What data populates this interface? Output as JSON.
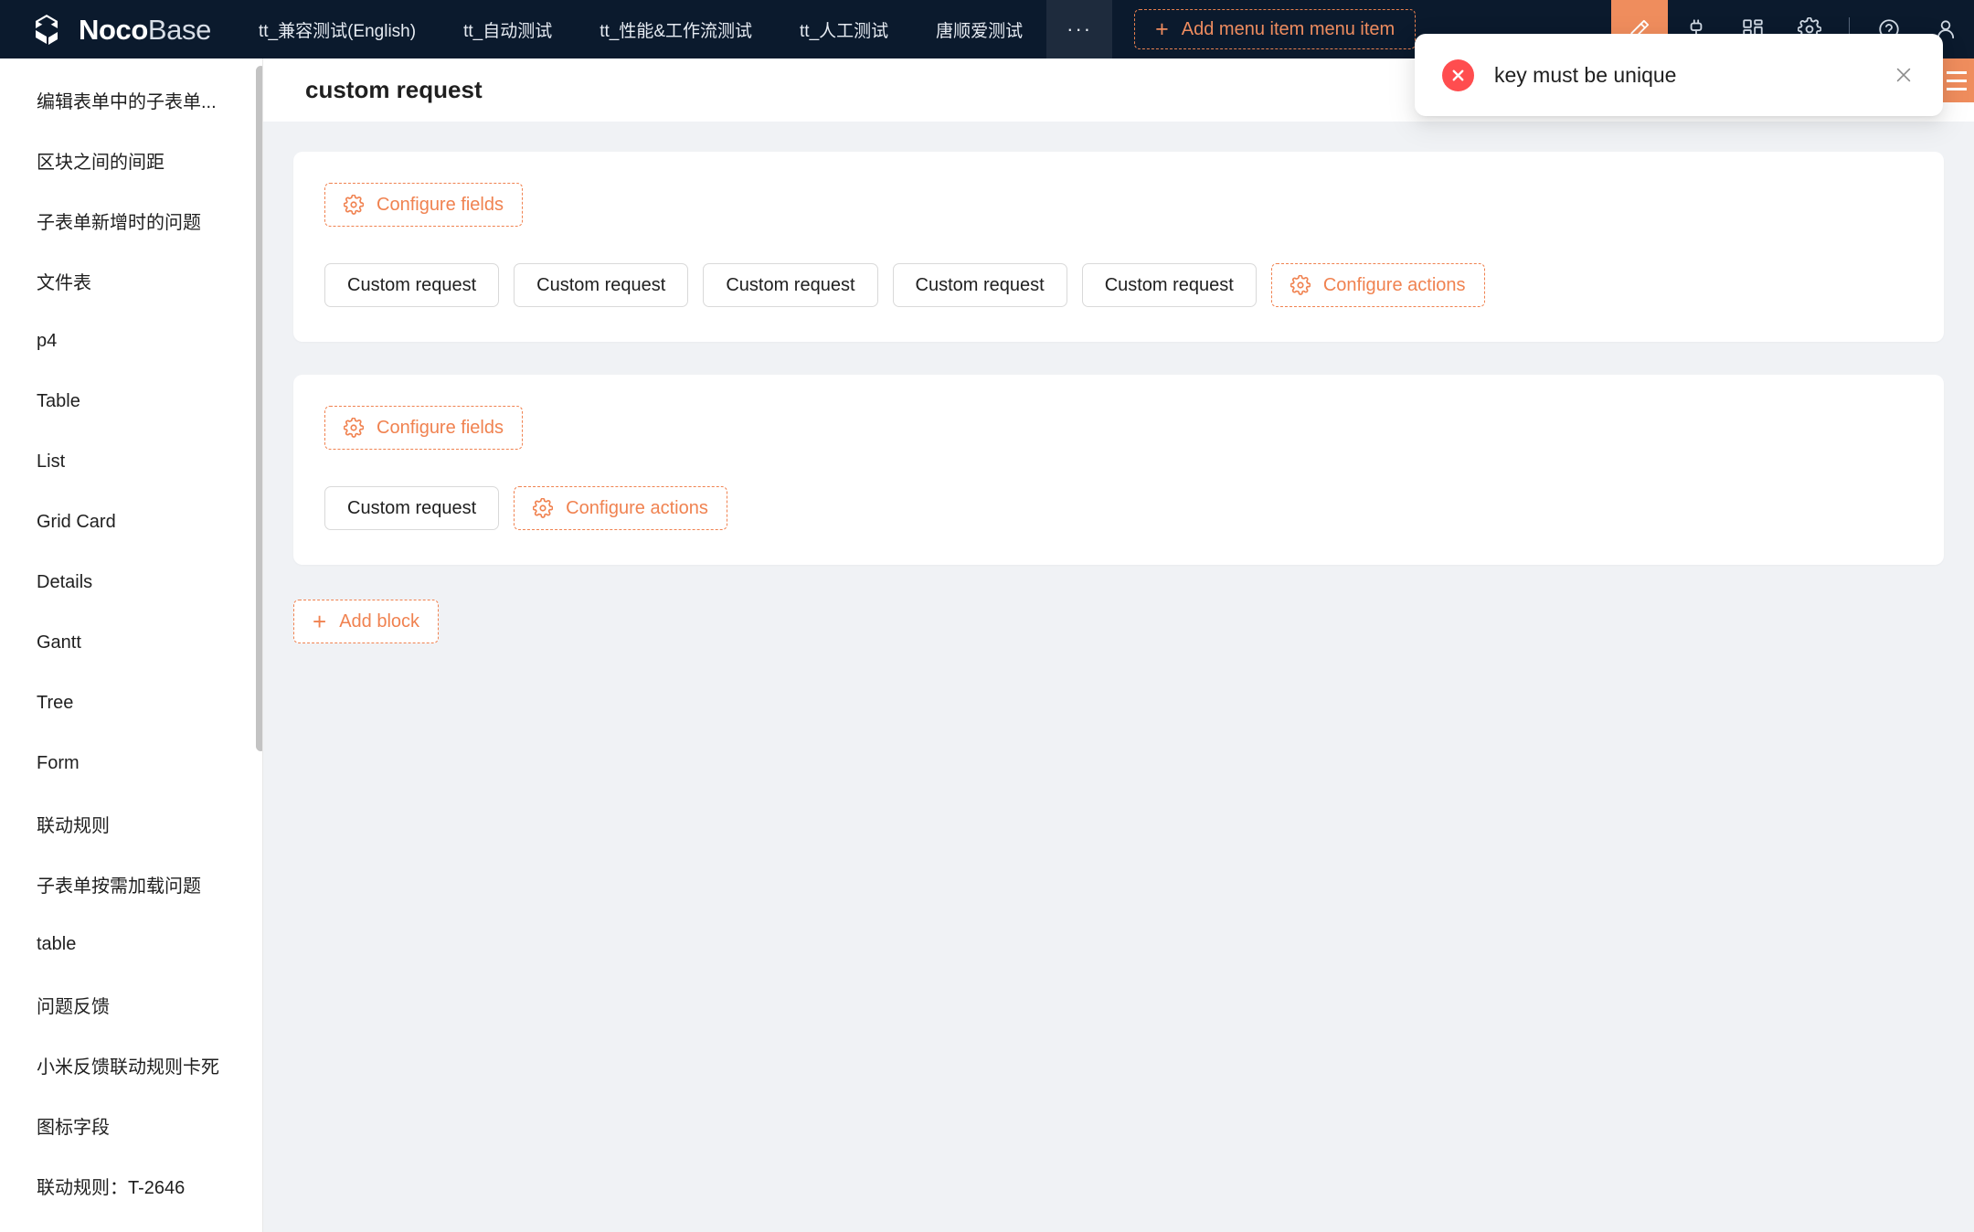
{
  "brand": {
    "part1": "Noco",
    "part2": "Base",
    "logo_icon": "nocobase-cube-logo"
  },
  "topbar": {
    "tabs": [
      {
        "label": "tt_兼容测试(English)",
        "name": "tab-compat-test"
      },
      {
        "label": "tt_自动测试",
        "name": "tab-auto-test"
      },
      {
        "label": "tt_性能&工作流测试",
        "name": "tab-perf-workflow-test"
      },
      {
        "label": "tt_人工测试",
        "name": "tab-manual-test"
      },
      {
        "label": "唐顺爱测试",
        "name": "tab-tangshunai-test"
      }
    ],
    "more_label": "···",
    "add_menu_item_label": "Add menu item menu item",
    "add_menu_item_plus": "+",
    "icons": [
      {
        "name": "ui-editor-icon",
        "active": true
      },
      {
        "name": "plugin-manager-icon",
        "active": false
      },
      {
        "name": "apps-grid-icon",
        "active": false
      },
      {
        "name": "settings-gear-icon",
        "active": false
      },
      {
        "name": "help-circle-icon",
        "active": false
      },
      {
        "name": "user-avatar-icon",
        "active": false
      }
    ]
  },
  "sidebar": {
    "items": [
      {
        "label": "编辑表单中的子表单..."
      },
      {
        "label": "区块之间的间距"
      },
      {
        "label": "子表单新增时的问题"
      },
      {
        "label": "文件表"
      },
      {
        "label": "p4"
      },
      {
        "label": "Table"
      },
      {
        "label": "List"
      },
      {
        "label": "Grid Card"
      },
      {
        "label": "Details"
      },
      {
        "label": "Gantt"
      },
      {
        "label": "Tree"
      },
      {
        "label": "Form"
      },
      {
        "label": "联动规则"
      },
      {
        "label": "子表单按需加载问题"
      },
      {
        "label": "table"
      },
      {
        "label": "问题反馈"
      },
      {
        "label": "小米反馈联动规则卡死"
      },
      {
        "label": "图标字段"
      },
      {
        "label": "联动规则：T-2646"
      }
    ]
  },
  "page": {
    "title": "custom request",
    "blocks": [
      {
        "configure_fields_label": "Configure fields",
        "actions": [
          {
            "label": "Custom request"
          },
          {
            "label": "Custom request"
          },
          {
            "label": "Custom request"
          },
          {
            "label": "Custom request"
          },
          {
            "label": "Custom request"
          }
        ],
        "configure_actions_label": "Configure actions"
      },
      {
        "configure_fields_label": "Configure fields",
        "actions": [
          {
            "label": "Custom request"
          }
        ],
        "configure_actions_label": "Configure actions"
      }
    ],
    "add_block_label": "Add block",
    "add_block_plus": "+"
  },
  "toast": {
    "message": "key must be unique",
    "status_icon": "error-circle-icon",
    "close_icon": "close-icon"
  },
  "drawer": {
    "handle_icon": "hamburger-menu-icon"
  },
  "colors": {
    "header_bg": "#0b1a2d",
    "accent": "#f08250",
    "accent_active": "#ef8d5d",
    "error": "#ff4d4f",
    "page_bg": "#f0f2f5",
    "card_bg": "#ffffff"
  }
}
